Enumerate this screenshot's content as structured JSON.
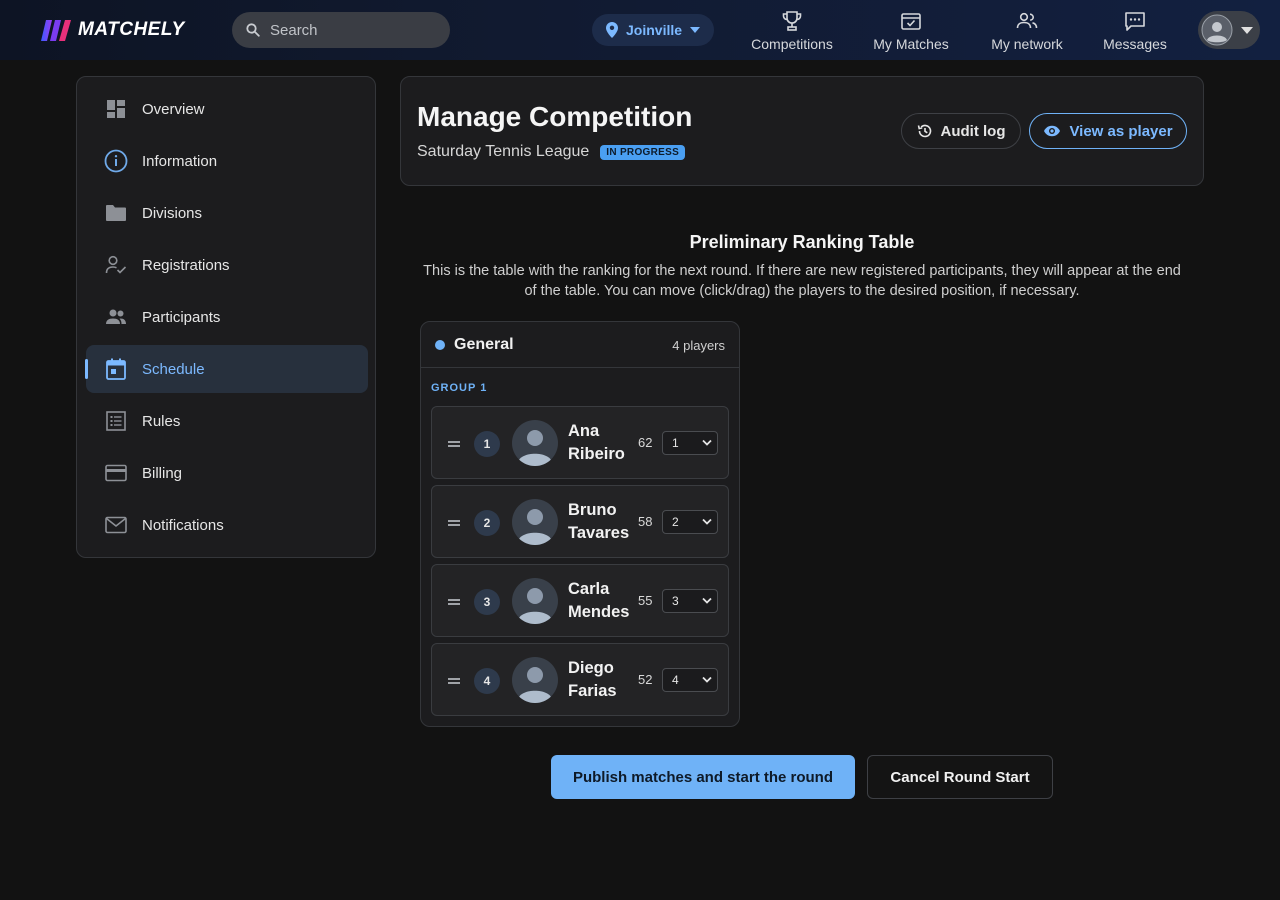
{
  "brand": {
    "name": "MATCHELY"
  },
  "search": {
    "placeholder": "Search"
  },
  "location": {
    "label": "Joinville"
  },
  "nav": [
    {
      "label": "Competitions",
      "icon": "trophy-icon"
    },
    {
      "label": "My Matches",
      "icon": "calendar-check-icon"
    },
    {
      "label": "My network",
      "icon": "people-icon"
    },
    {
      "label": "Messages",
      "icon": "message-icon"
    }
  ],
  "sidebar": {
    "items": [
      {
        "label": "Overview",
        "icon": "dashboard-icon"
      },
      {
        "label": "Information",
        "icon": "info-icon"
      },
      {
        "label": "Divisions",
        "icon": "folder-icon"
      },
      {
        "label": "Registrations",
        "icon": "person-check-icon"
      },
      {
        "label": "Participants",
        "icon": "people-icon"
      },
      {
        "label": "Schedule",
        "icon": "calendar-icon",
        "active": true
      },
      {
        "label": "Rules",
        "icon": "list-icon"
      },
      {
        "label": "Billing",
        "icon": "credit-card-icon"
      },
      {
        "label": "Notifications",
        "icon": "mail-icon"
      }
    ]
  },
  "manage": {
    "title": "Manage Competition",
    "competition": "Saturday Tennis League",
    "status": "IN PROGRESS",
    "audit_label": "Audit log",
    "view_label": "View as player"
  },
  "ranking": {
    "title": "Preliminary Ranking Table",
    "description": "This is the table with the ranking for the next round. If there are new registered participants, they will appear at the end of the table. You can move (click/drag) the players to the desired position, if necessary.",
    "division": {
      "name": "General",
      "count": "4 players",
      "group": "GROUP 1",
      "players": [
        {
          "position": "1",
          "first": "Ana",
          "last": "Ribeiro",
          "score": "62",
          "select": "1"
        },
        {
          "position": "2",
          "first": "Bruno",
          "last": "Tavares",
          "score": "58",
          "select": "2"
        },
        {
          "position": "3",
          "first": "Carla",
          "last": "Mendes",
          "score": "55",
          "select": "3"
        },
        {
          "position": "4",
          "first": "Diego",
          "last": "Farias",
          "score": "52",
          "select": "4"
        }
      ]
    }
  },
  "actions": {
    "publish": "Publish matches and start the round",
    "cancel": "Cancel Round Start"
  },
  "colors": {
    "accent": "#6fb2f7",
    "background": "#121212",
    "card": "#1c1c1e"
  }
}
